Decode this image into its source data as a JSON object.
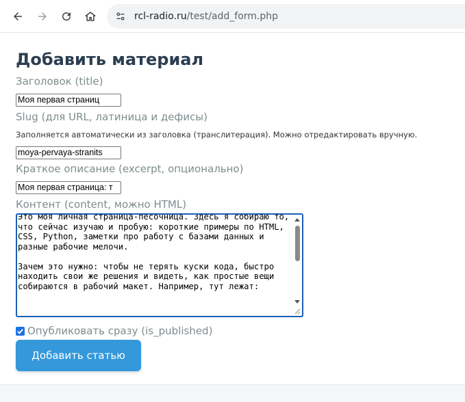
{
  "browser": {
    "url_host": "rcl-radio.ru",
    "url_path": "/test/add_form.php"
  },
  "form": {
    "heading": "Добавить материал",
    "title_label": "Заголовок (title)",
    "title_value": "Моя первая страниц",
    "slug_label": "Slug (для URL, латиница и дефисы)",
    "slug_hint": "Заполняется автоматически из заголовка (транслитерация). Можно отредактировать вручную.",
    "slug_value": "moya-pervaya-stranits",
    "excerpt_label": "Краткое описание (excerpt, опционально)",
    "excerpt_value": "Моя первая страница: т",
    "content_label": "Контент (content, можно HTML)",
    "content_value": "Это моя личная страница-песочница. Здесь я собираю то, что сейчас изучаю и пробую: короткие примеры по HTML, CSS, Python, заметки про работу с базами данных и разные рабочие мелочи.\n\nЗачем это нужно: чтобы не терять куски кода, быстро находить свои же решения и видеть, как простые вещи собираются в рабочий макет. Например, тут лежат:",
    "publish_label": "Опубликовать сразу (is_published)",
    "publish_checked": true,
    "submit_label": "Добавить статью"
  },
  "colors": {
    "accent": "#3498db",
    "heading": "#2c3e50",
    "label": "#7f8c8d",
    "focus": "#1a5fb4"
  },
  "icons": [
    "back-arrow-icon",
    "forward-arrow-icon",
    "reload-icon",
    "home-icon",
    "site-info-icon",
    "checkmark-icon",
    "resize-grip-icon"
  ]
}
